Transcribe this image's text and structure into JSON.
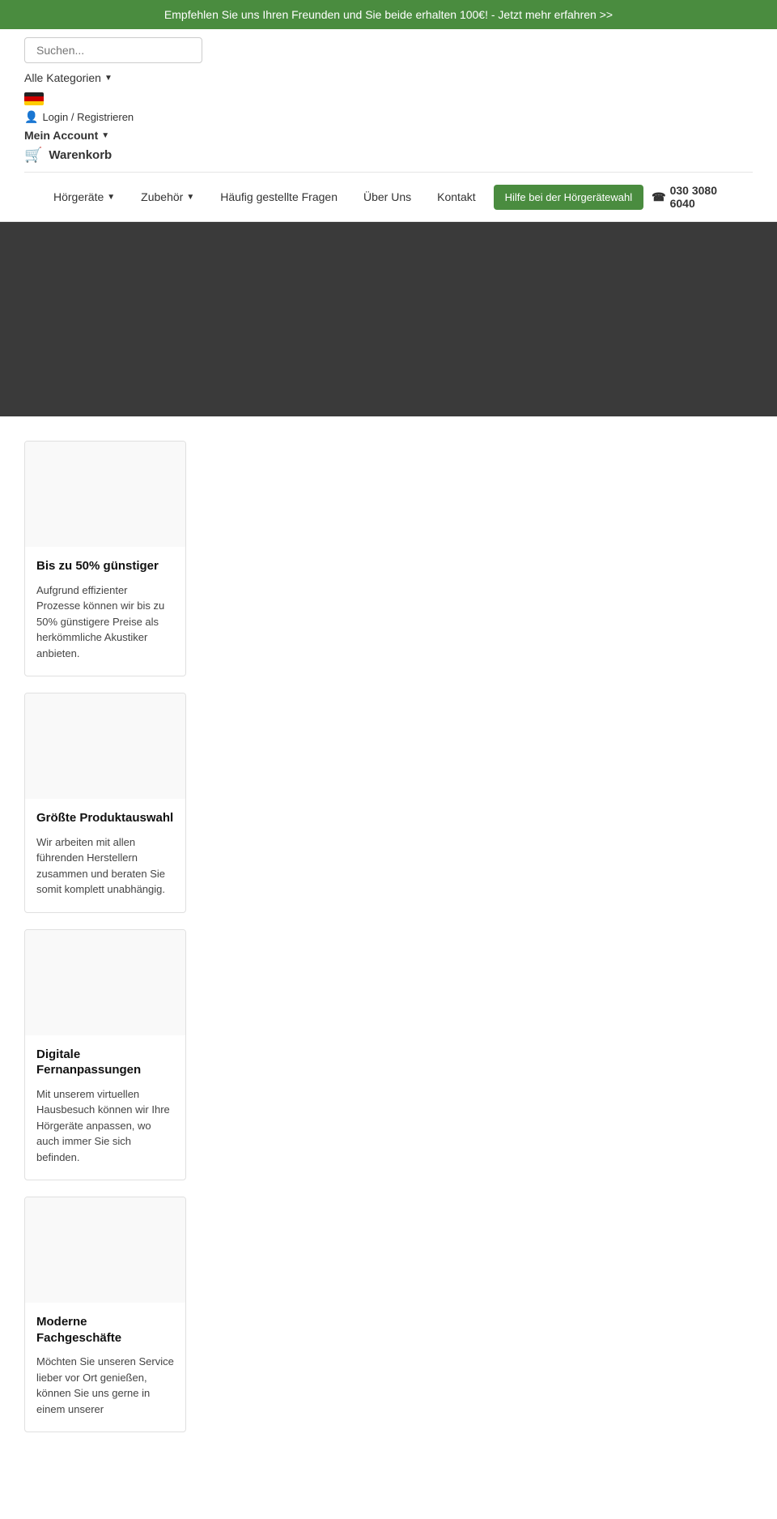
{
  "banner": {
    "text": "Empfehlen Sie uns Ihren Freunden und Sie beide erhalten 100€! - Jetzt mehr erfahren >>"
  },
  "header": {
    "search_placeholder": "Suchen...",
    "categories_label": "Alle Kategorien",
    "region_label": "Region",
    "login_label": "Login / Registrieren",
    "my_account_label": "Mein Account",
    "cart_label": "Warenkorb"
  },
  "nav": {
    "items": [
      {
        "label": "Hörgeräte",
        "has_dropdown": true
      },
      {
        "label": "Zubehör",
        "has_dropdown": true
      },
      {
        "label": "Häufig gestellte Fragen",
        "has_dropdown": false
      },
      {
        "label": "Über Uns",
        "has_dropdown": false
      },
      {
        "label": "Kontakt",
        "has_dropdown": false
      }
    ],
    "cta_label": "Hilfe bei der Hörgerätewahl",
    "phone": "030 3080 6040"
  },
  "features": [
    {
      "title": "Bis zu 50% günstiger",
      "text": "Aufgrund effizienter Prozesse können wir bis zu 50% günstigere Preise als herkömmliche Akustiker anbieten."
    },
    {
      "title": "Größte Produktauswahl",
      "text": "Wir arbeiten mit allen führenden Herstellern zusammen und beraten Sie somit komplett unabhängig."
    },
    {
      "title": "Digitale Fernanpassungen",
      "text": "Mit unserem virtuellen Hausbesuch können wir Ihre Hörgeräte anpassen, wo auch immer Sie sich befinden."
    },
    {
      "title": "Moderne Fachgeschäfte",
      "text": "Möchten Sie unseren Service lieber vor Ort genießen, können Sie uns gerne in einem unserer"
    }
  ],
  "colors": {
    "green": "#4a8c3f",
    "dark_bg": "#3a3a3a"
  }
}
